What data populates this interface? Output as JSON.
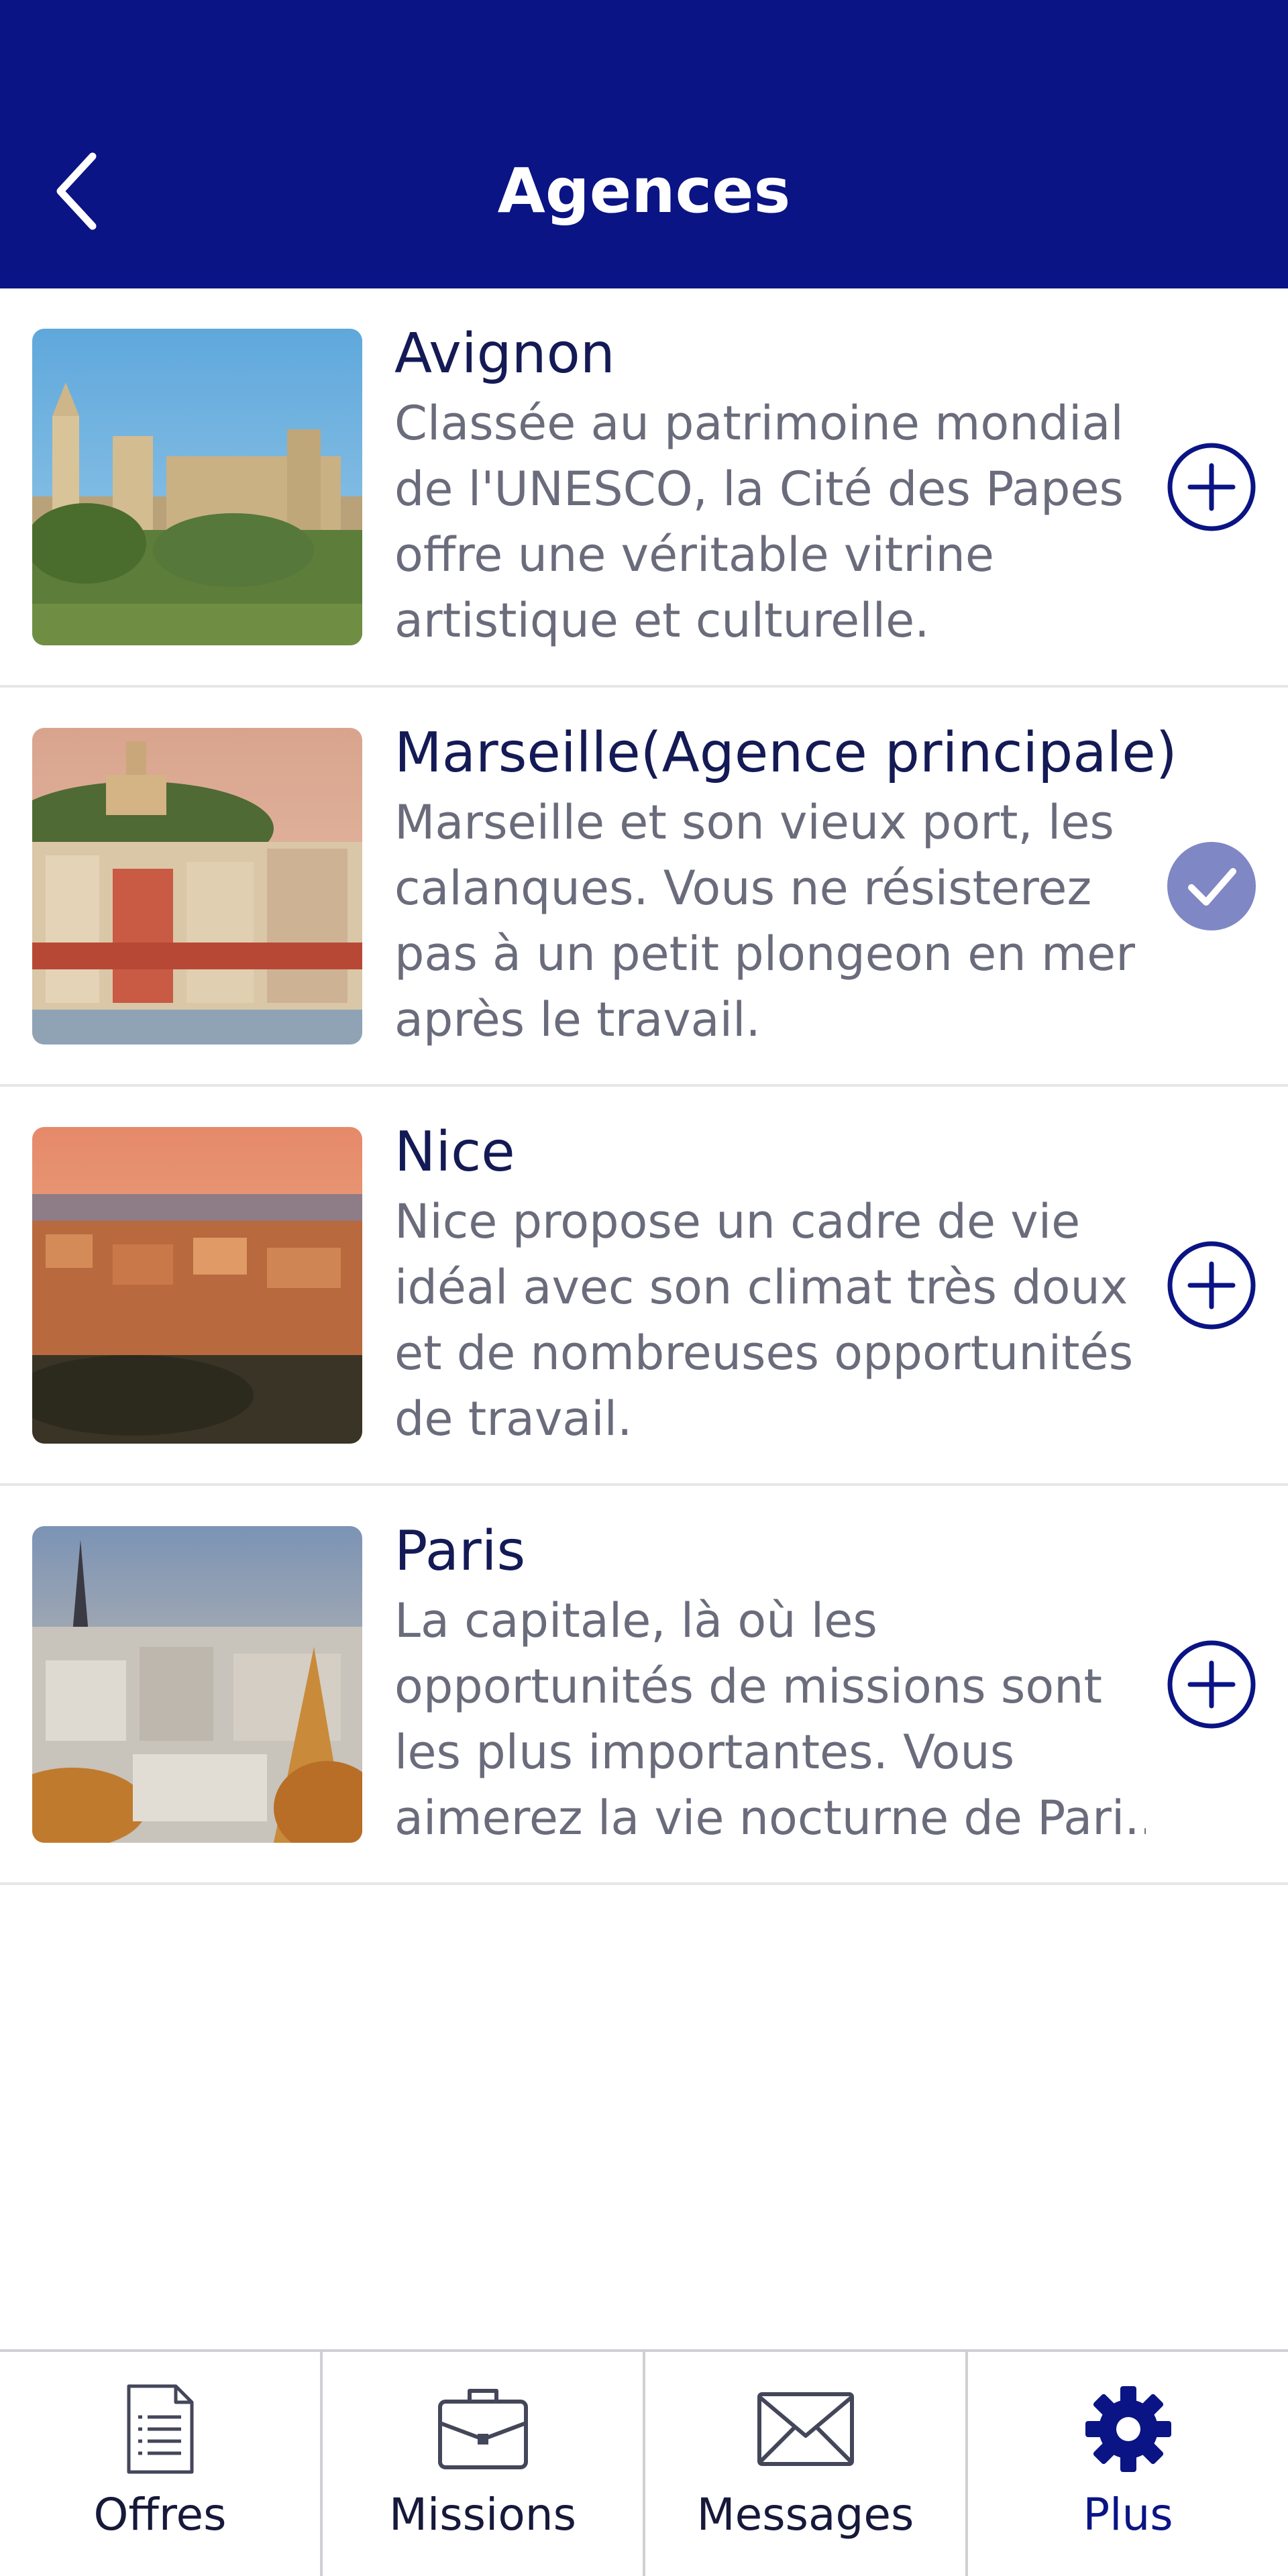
{
  "header": {
    "title": "Agences"
  },
  "agencies": [
    {
      "name": "Avignon",
      "description_lines": [
        "Classée au patrimoine mondial",
        "de l'UNESCO, la Cité des Papes",
        "offre une véritable vitrine",
        "artistique et culturelle."
      ],
      "state": "add",
      "icon": "plus-circle-icon"
    },
    {
      "name": "Marseille(Agence principale)",
      "description_lines": [
        "Marseille et son vieux port, les",
        "calanques. Vous ne résisterez",
        "pas à un petit plongeon en mer",
        "après le travail."
      ],
      "state": "selected",
      "icon": "check-circle-icon"
    },
    {
      "name": "Nice",
      "description_lines": [
        "Nice propose un cadre de vie",
        "idéal avec son climat très doux",
        "et de nombreuses opportunités",
        "de travail."
      ],
      "state": "add",
      "icon": "plus-circle-icon"
    },
    {
      "name": "Paris",
      "description_lines": [
        "La capitale, là où les",
        "opportunités de missions sont",
        "les plus importantes. Vous",
        "aimerez la vie nocturne de Pari..."
      ],
      "state": "add",
      "icon": "plus-circle-icon"
    }
  ],
  "tabbar": {
    "tabs": [
      {
        "label": "Offres",
        "icon": "document-icon",
        "active": false
      },
      {
        "label": "Missions",
        "icon": "briefcase-icon",
        "active": false
      },
      {
        "label": "Messages",
        "icon": "envelope-icon",
        "active": false
      },
      {
        "label": "Plus",
        "icon": "gear-icon",
        "active": true
      }
    ]
  },
  "colors": {
    "primary": "#0a1484",
    "selected_check": "#7f87c4",
    "title_text": "#141a55",
    "description_text": "#6a6c7c"
  }
}
